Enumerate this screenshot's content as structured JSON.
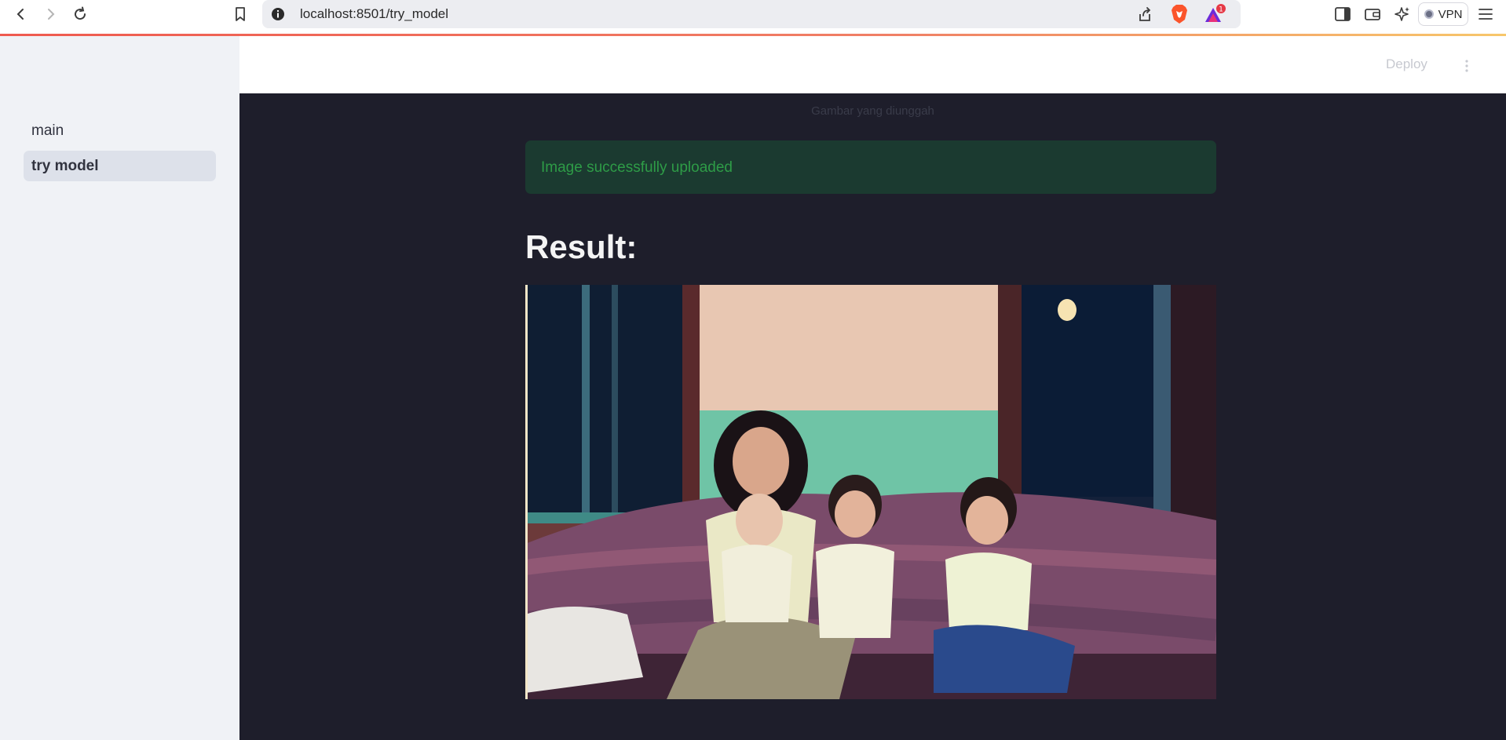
{
  "browser": {
    "url": "localhost:8501/try_model",
    "rewards_badge": "1",
    "vpn_label": "VPN"
  },
  "sidebar": {
    "items": [
      {
        "label": "main",
        "active": false
      },
      {
        "label": "try model",
        "active": true
      }
    ]
  },
  "header": {
    "deploy_label": "Deploy"
  },
  "main": {
    "image_caption": "Gambar yang diunggah",
    "alert_text": "Image successfully uploaded",
    "result_title": "Result:"
  },
  "colors": {
    "background": "#1e1e2b",
    "sidebar": "#f0f2f6",
    "success_bg": "#1b3a30",
    "success_text": "#2e9c47",
    "accent_line": "#ef5a4f"
  }
}
